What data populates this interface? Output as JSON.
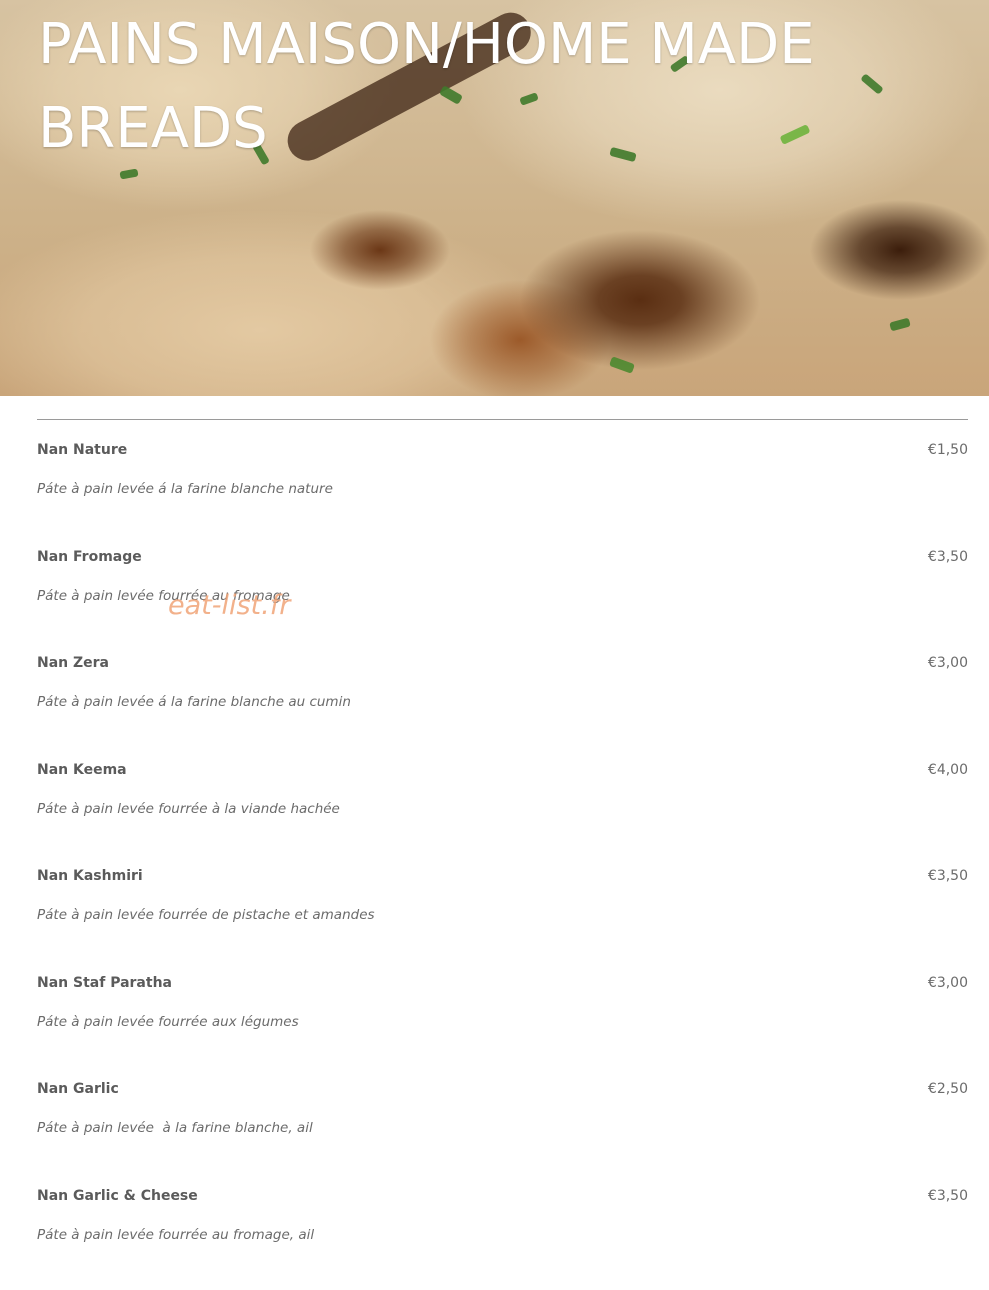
{
  "header": {
    "title": "PAINS MAISON/HOME MADE BREADS"
  },
  "watermark": "eat-list.fr",
  "menu": {
    "items": [
      {
        "name": "Nan Nature",
        "price": "€1,50",
        "description": "Páte à pain levée á la farine blanche nature"
      },
      {
        "name": "Nan Fromage",
        "price": "€3,50",
        "description": "Páte à pain levée fourrée au fromage"
      },
      {
        "name": "Nan Zera",
        "price": "€3,00",
        "description": "Páte à pain levée á la farine blanche au cumin"
      },
      {
        "name": "Nan Keema",
        "price": "€4,00",
        "description": "Páte à pain levée fourrée à la viande hachée"
      },
      {
        "name": "Nan Kashmiri",
        "price": "€3,50",
        "description": "Páte à pain levée fourrée de pistache et amandes"
      },
      {
        "name": "Nan Staf Paratha",
        "price": "€3,00",
        "description": "Páte à pain levée fourrée aux légumes"
      },
      {
        "name": "Nan Garlic",
        "price": "€2,50",
        "description": "Páte à pain levée  à la farine blanche, ail"
      },
      {
        "name": "Nan Garlic & Cheese",
        "price": "€3,50",
        "description": "Páte à pain levée fourrée au fromage, ail"
      }
    ]
  }
}
